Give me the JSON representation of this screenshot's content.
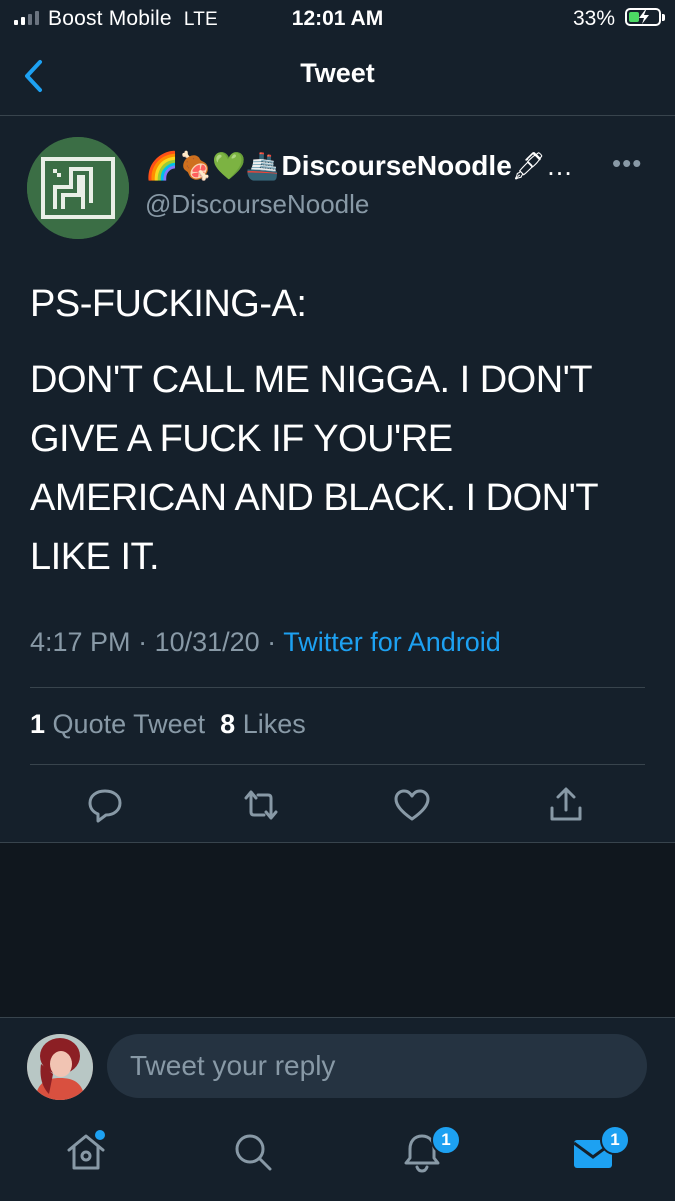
{
  "status_bar": {
    "carrier": "Boost Mobile",
    "network": "LTE",
    "time": "12:01 AM",
    "battery": "33%",
    "battery_state": "charging"
  },
  "nav": {
    "title": "Tweet",
    "back_icon": "chevron-left-icon"
  },
  "tweet": {
    "author": {
      "emojis": "🌈🍖💚🚢",
      "name": "DiscourseNoodle",
      "name_suffix": "🖋…",
      "handle": "@DiscourseNoodle"
    },
    "body": [
      "PS-FUCKING-A:",
      "DON'T CALL ME NIGGA. I DON'T",
      "GIVE A FUCK IF YOU'RE",
      "AMERICAN AND BLACK. I DON'T",
      "LIKE IT."
    ],
    "time": "4:17 PM",
    "date": "10/31/20",
    "separator": " · ",
    "source": "Twitter for Android",
    "stats": {
      "quote_count": "1",
      "quote_label": "Quote Tweet",
      "like_count": "8",
      "like_label": "Likes"
    },
    "actions": [
      "reply-icon",
      "retweet-icon",
      "like-icon",
      "share-icon"
    ]
  },
  "reply": {
    "placeholder": "Tweet your reply"
  },
  "tabbar": {
    "notifications_badge": "1",
    "messages_badge": "1"
  },
  "colors": {
    "background": "#15202b",
    "accent": "#1da1f2",
    "secondary_text": "#8899a6",
    "divider": "#38444d"
  }
}
